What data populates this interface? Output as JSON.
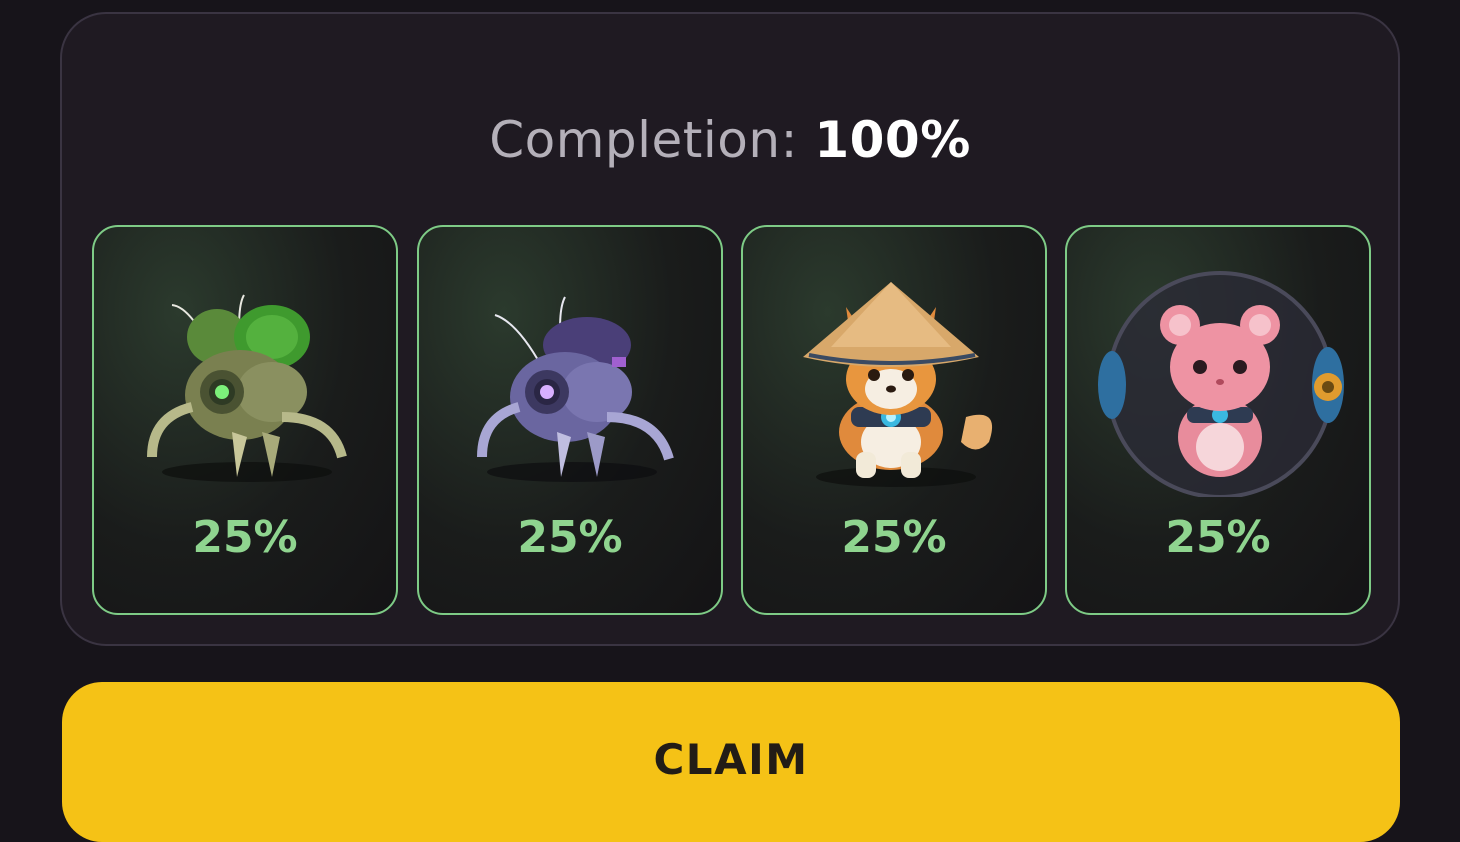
{
  "completion": {
    "label": "Completion: ",
    "value": "100%"
  },
  "cards": [
    {
      "name": "green-bug",
      "icon": "green-mech-bug-icon",
      "percent": "25%",
      "accent": "#7ecb86"
    },
    {
      "name": "purple-bug",
      "icon": "purple-mech-bug-icon",
      "percent": "25%",
      "accent": "#7ecb86"
    },
    {
      "name": "shiba-dog",
      "icon": "shiba-straw-hat-icon",
      "percent": "25%",
      "accent": "#7ecb86"
    },
    {
      "name": "hamster-ball",
      "icon": "hamster-in-ball-icon",
      "percent": "25%",
      "accent": "#7ecb86"
    }
  ],
  "claim_label": "CLAIM",
  "colors": {
    "claim": "#f5c216",
    "card_border": "#7ecb86",
    "percent": "#8fd48f"
  }
}
